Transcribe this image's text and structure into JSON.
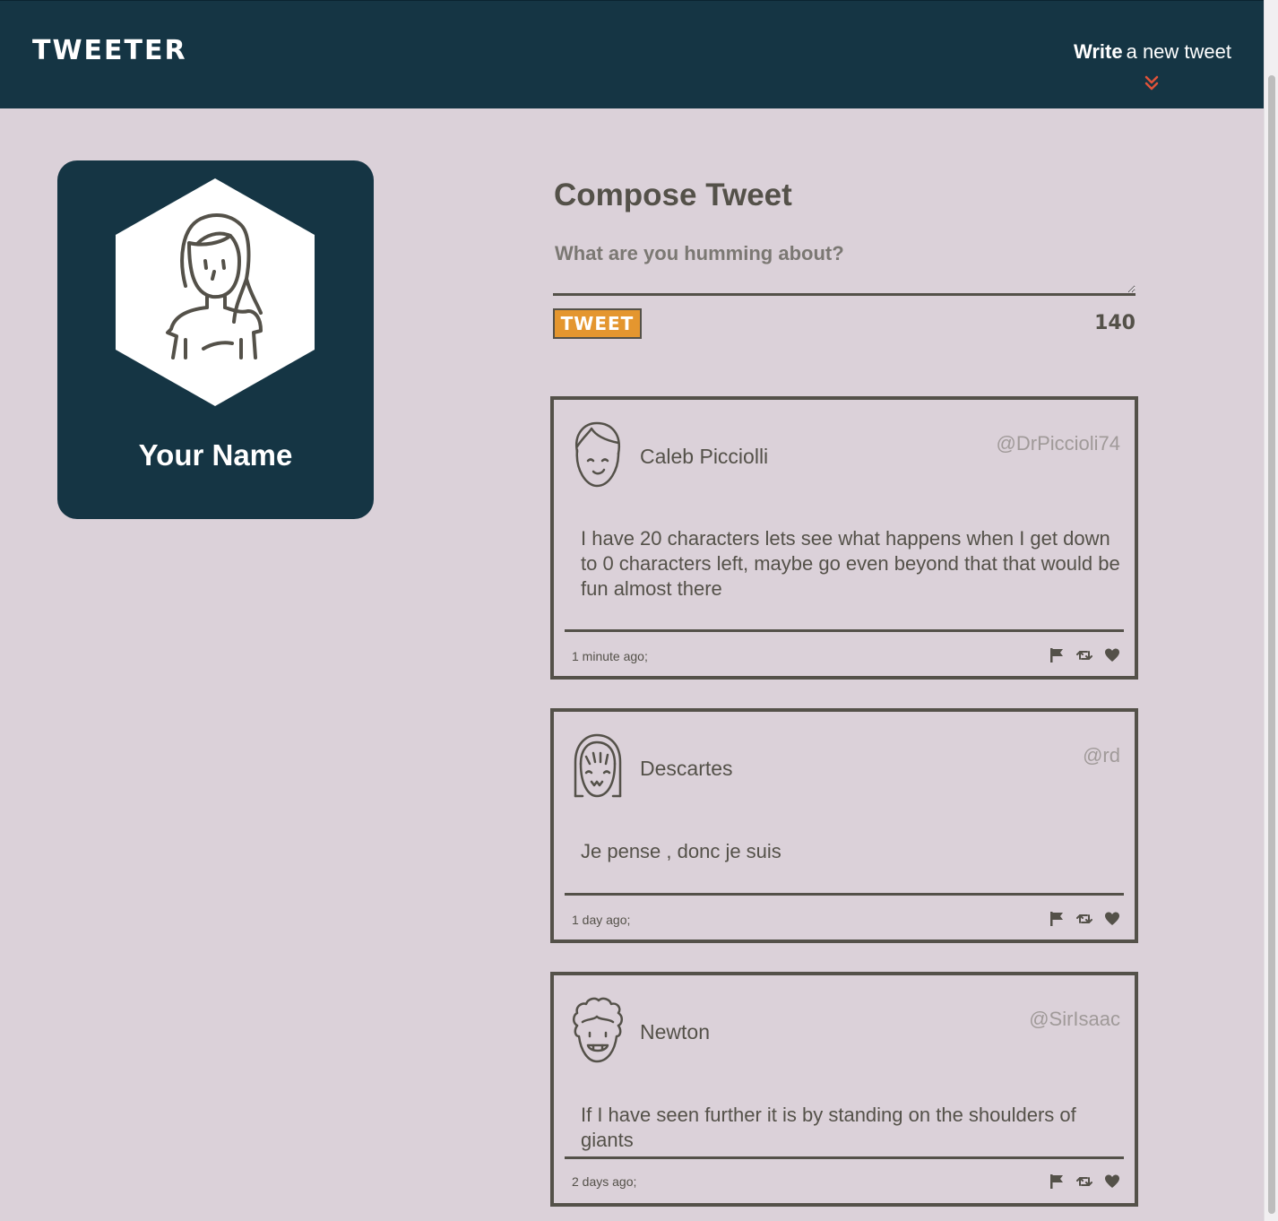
{
  "nav": {
    "brand": "TWEETER",
    "write_bold": "Write",
    "write_rest": "a new tweet",
    "chevron_icon": "double-chevron-down",
    "chevron_color": "#e0533a"
  },
  "profile": {
    "name": "Your Name",
    "avatar_icon": "girl-avatar"
  },
  "compose": {
    "title": "Compose Tweet",
    "placeholder": "What are you humming about?",
    "button_label": "TWEET",
    "counter": "140"
  },
  "tweets": [
    {
      "author": "Caleb Picciolli",
      "handle": "@DrPiccioli74",
      "text": "I have 20 characters lets see what happens when I get down to 0 characters left, maybe go even beyond that that would be fun almost there",
      "time": "1 minute ago;",
      "avatar_icon": "boy-avatar"
    },
    {
      "author": "Descartes",
      "handle": "@rd",
      "text": "Je pense , donc je suis",
      "time": "1 day ago;",
      "avatar_icon": "bangs-avatar"
    },
    {
      "author": "Newton",
      "handle": "@SirIsaac",
      "text": "If I have seen further it is by standing on the shoulders of giants",
      "time": "2 days ago;",
      "avatar_icon": "curly-avatar"
    }
  ],
  "colors": {
    "nav_bg": "#153544",
    "page_bg": "#dbd1d9",
    "text": "#545149",
    "button": "#e4962f",
    "handle": "#a09a99"
  }
}
